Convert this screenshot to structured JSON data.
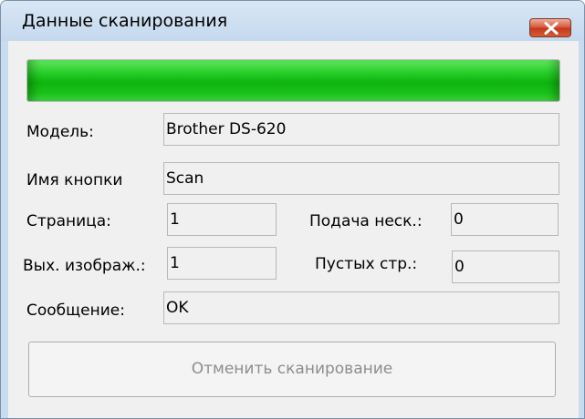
{
  "window": {
    "title": "Данные сканирования",
    "close_icon": "close-x-icon"
  },
  "progress": {
    "percent": 100,
    "color": "#1cc21c"
  },
  "fields": {
    "model": {
      "label": "Модель:",
      "value": "Brother DS-620"
    },
    "button_name": {
      "label": "Имя кнопки",
      "value": "Scan"
    },
    "page": {
      "label": "Страница:",
      "value": "1"
    },
    "multifeed": {
      "label": "Подача неск.:",
      "value": "0"
    },
    "output_images": {
      "label": "Вых. изображ.:",
      "value": "1"
    },
    "blank_pages": {
      "label": "Пустых стр.:",
      "value": "0"
    },
    "message": {
      "label": "Сообщение:",
      "value": "OK"
    }
  },
  "actions": {
    "cancel_label": "Отменить сканирование",
    "cancel_enabled": false
  }
}
